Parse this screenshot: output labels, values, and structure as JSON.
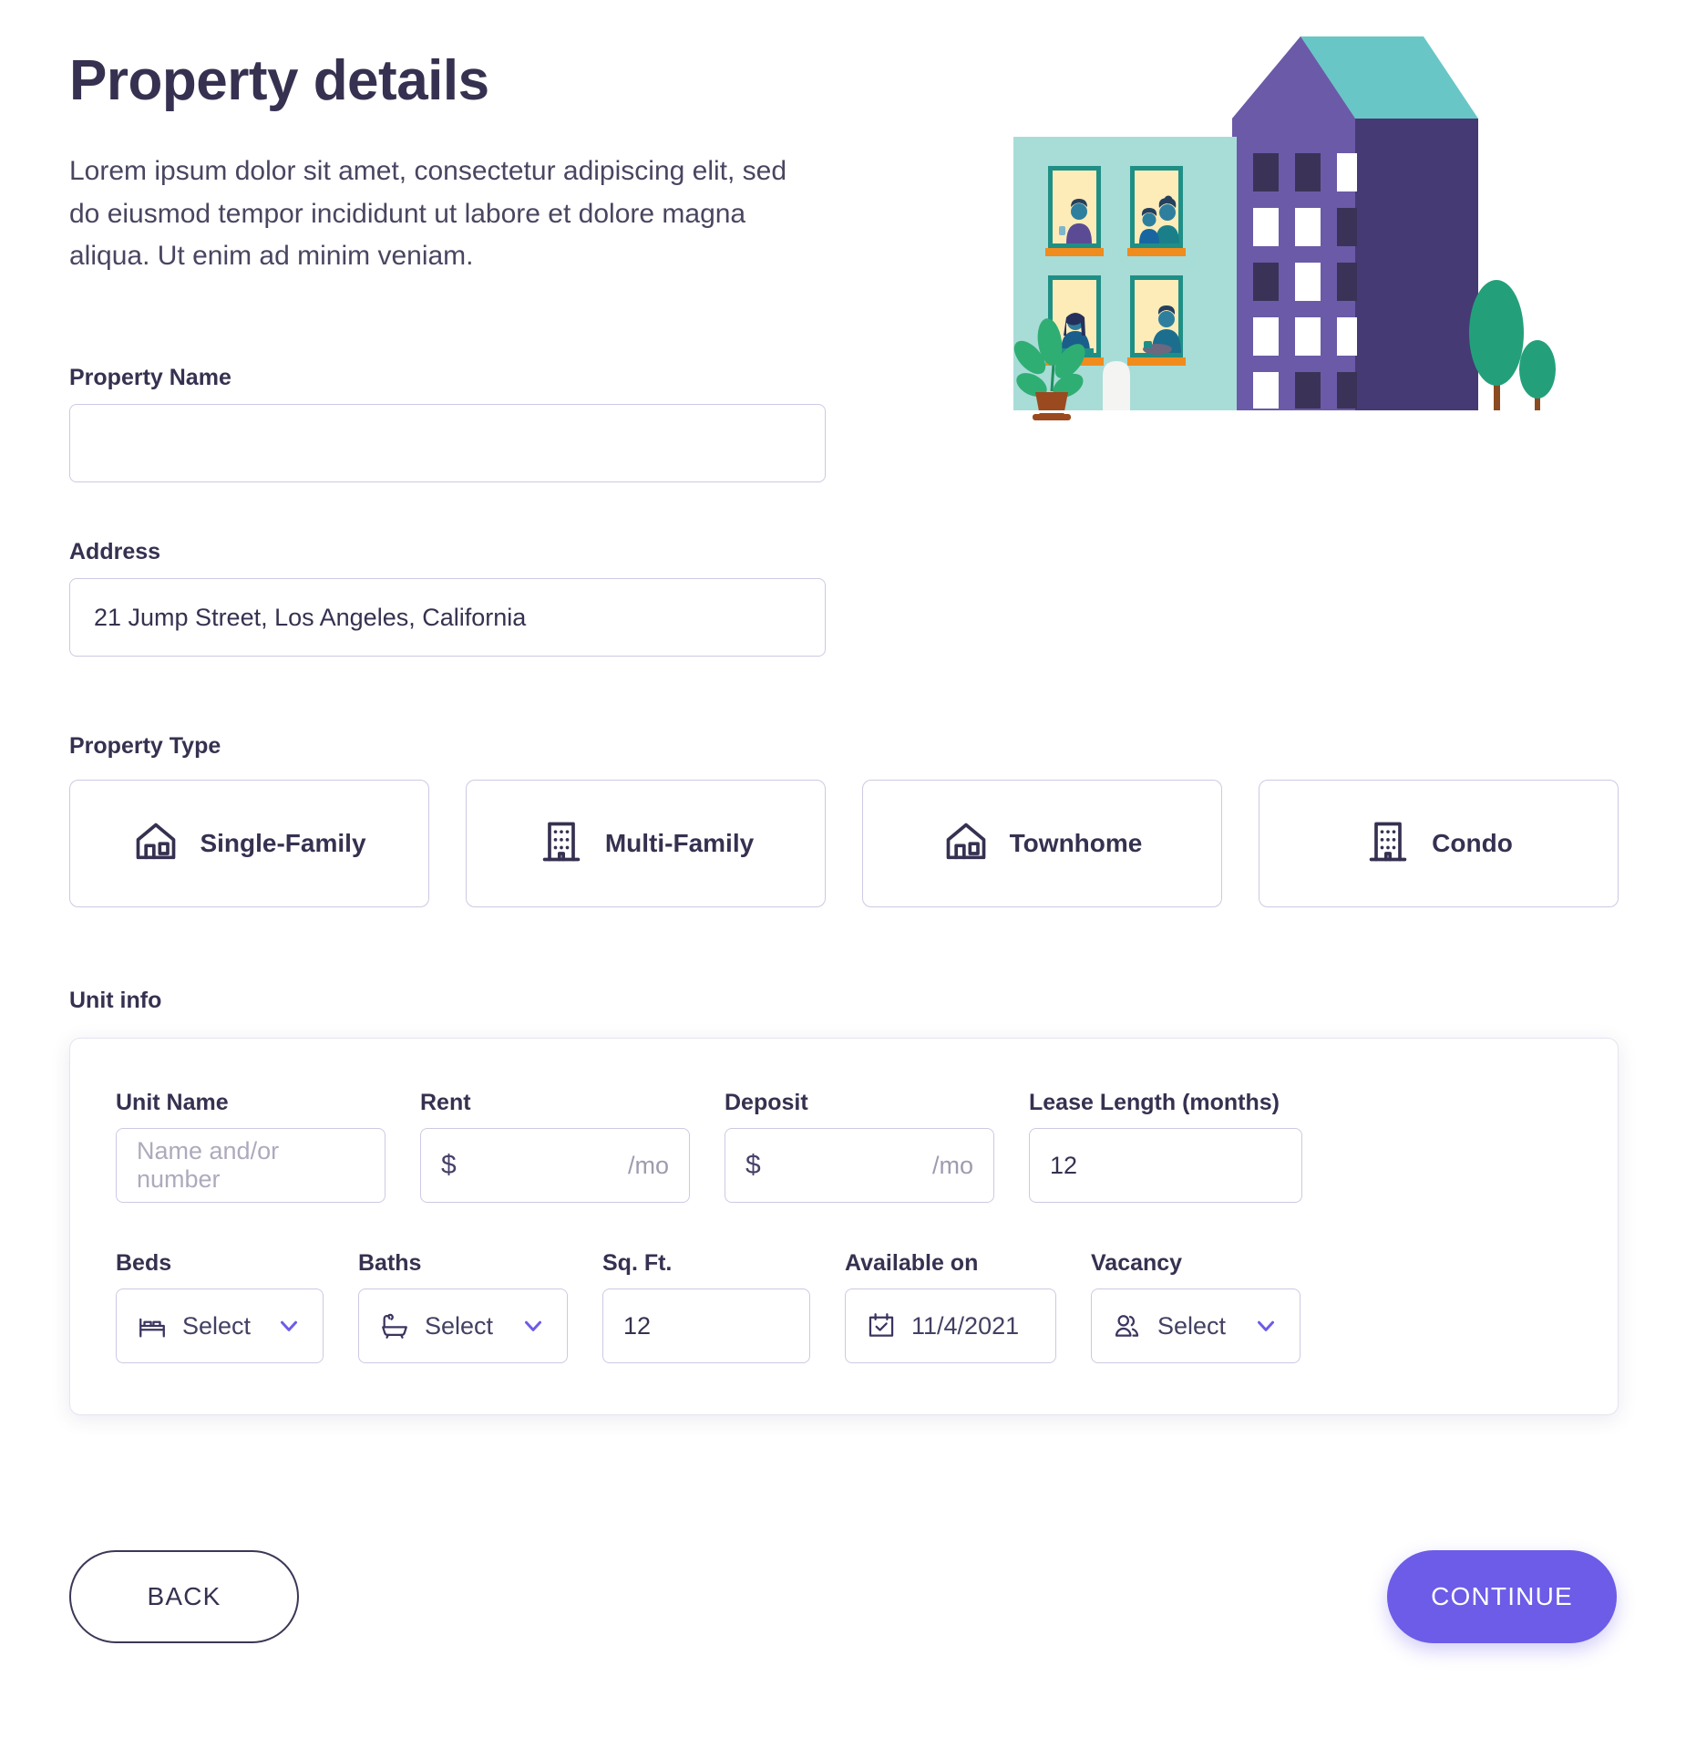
{
  "header": {
    "title": "Property details",
    "subtitle": "Lorem ipsum dolor sit amet, consectetur adipiscing elit, sed do eiusmod tempor incididunt ut labore et dolore magna aliqua. Ut enim ad minim veniam."
  },
  "colors": {
    "accent": "#6c5ce7",
    "text": "#363150",
    "border": "#cdc9e3",
    "placeholder": "#aeaabd",
    "illustration_wall": "#a8dcd7",
    "illustration_building": "#6b5aa8",
    "illustration_building_side": "#453a74",
    "illustration_roof": "#68c6c6",
    "illustration_sill": "#f08b1d",
    "illustration_window": "#fdecb8"
  },
  "fields": {
    "property_name": {
      "label": "Property Name",
      "value": "",
      "placeholder": ""
    },
    "address": {
      "label": "Address",
      "value": "21 Jump Street, Los Angeles, California",
      "placeholder": ""
    }
  },
  "property_type": {
    "label": "Property Type",
    "options": [
      {
        "label": "Single-Family",
        "icon": "house-icon",
        "selected": false
      },
      {
        "label": "Multi-Family",
        "icon": "building-icon",
        "selected": false
      },
      {
        "label": "Townhome",
        "icon": "house-icon",
        "selected": false
      },
      {
        "label": "Condo",
        "icon": "building-icon",
        "selected": false
      }
    ]
  },
  "unit_info": {
    "label": "Unit info",
    "unit_name": {
      "label": "Unit Name",
      "value": "",
      "placeholder": "Name and/or number"
    },
    "rent": {
      "label": "Rent",
      "prefix": "$",
      "value": "",
      "suffix": "/mo"
    },
    "deposit": {
      "label": "Deposit",
      "prefix": "$",
      "value": "",
      "suffix": "/mo"
    },
    "lease_length": {
      "label": "Lease Length (months)",
      "value": "12"
    },
    "beds": {
      "label": "Beds",
      "value": "Select",
      "icon": "bed-icon"
    },
    "baths": {
      "label": "Baths",
      "value": "Select",
      "icon": "bathtub-icon"
    },
    "sqft": {
      "label": "Sq. Ft.",
      "value": "12"
    },
    "available_on": {
      "label": "Available on",
      "value": "11/4/2021",
      "icon": "calendar-check-icon"
    },
    "vacancy": {
      "label": "Vacancy",
      "value": "Select",
      "icon": "people-icon"
    }
  },
  "footer": {
    "back_label": "BACK",
    "continue_label": "CONTINUE"
  }
}
